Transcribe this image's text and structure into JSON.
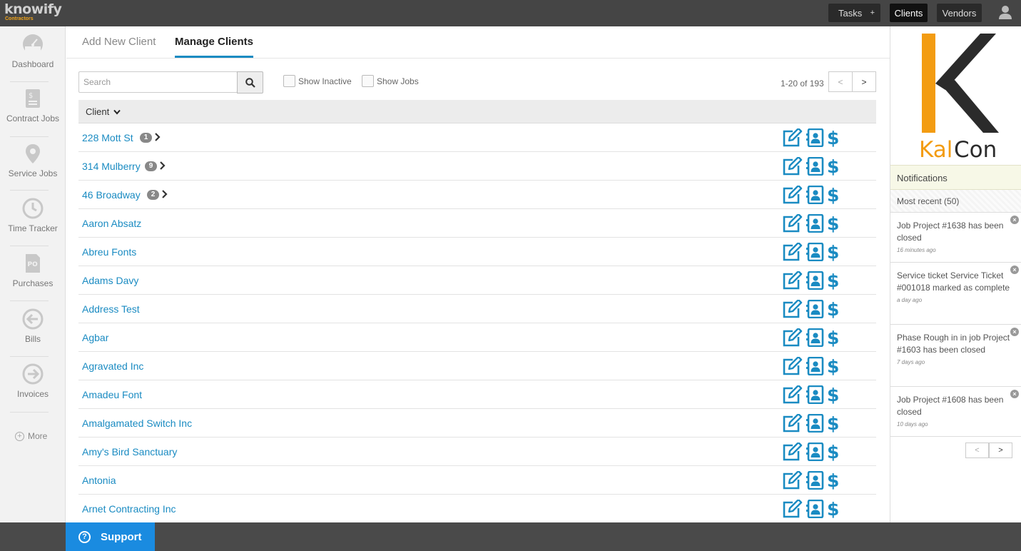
{
  "app": {
    "logo_main": "knowify",
    "logo_sub": "Contractors"
  },
  "topbar": {
    "tasks_label": "Tasks",
    "tasks_plus": "+",
    "clients_label": "Clients",
    "vendors_label": "Vendors"
  },
  "sidebar": {
    "items": [
      {
        "label": "Dashboard",
        "icon": "speedometer-icon"
      },
      {
        "label": "Contract Jobs",
        "icon": "contract-doc-icon"
      },
      {
        "label": "Service Jobs",
        "icon": "map-pin-icon"
      },
      {
        "label": "Time Tracker",
        "icon": "clock-icon"
      },
      {
        "label": "Purchases",
        "icon": "po-doc-icon"
      },
      {
        "label": "Bills",
        "icon": "arrow-left-circle-icon"
      },
      {
        "label": "Invoices",
        "icon": "arrow-right-circle-icon"
      }
    ],
    "more_label": "More"
  },
  "tabs": {
    "add_label": "Add New Client",
    "manage_label": "Manage Clients"
  },
  "toolbar": {
    "search_placeholder": "Search",
    "show_inactive_label": "Show Inactive",
    "show_jobs_label": "Show Jobs",
    "pager_text": "1-20 of 193",
    "prev_label": "<",
    "next_label": ">"
  },
  "table": {
    "header": "Client",
    "rows": [
      {
        "name": "228 Mott St",
        "badge": "1"
      },
      {
        "name": "314 Mulberry",
        "badge": "9"
      },
      {
        "name": "46 Broadway",
        "badge": "2"
      },
      {
        "name": "Aaron Absatz"
      },
      {
        "name": "Abreu Fonts"
      },
      {
        "name": "Adams Davy"
      },
      {
        "name": "Address Test"
      },
      {
        "name": "Agbar"
      },
      {
        "name": "Agravated Inc"
      },
      {
        "name": "Amadeu Font"
      },
      {
        "name": "Amalgamated Switch Inc"
      },
      {
        "name": "Amy's Bird Sanctuary"
      },
      {
        "name": "Antonia"
      },
      {
        "name": "Arnet Contracting Inc"
      }
    ]
  },
  "brand": {
    "name_prefix": "Kal",
    "name_suffix": "Con"
  },
  "notifications": {
    "title": "Notifications",
    "recent_label": "Most recent (50)",
    "items": [
      {
        "message": "Job Project #1638 has been closed",
        "time": "16 minutes ago"
      },
      {
        "message": "Service ticket Service Ticket #001018 marked as complete",
        "time": "a day ago"
      },
      {
        "message": "Phase Rough in in job Project #1603 has been closed",
        "time": "7 days ago"
      },
      {
        "message": "Job Project #1608 has been closed",
        "time": "10 days ago"
      }
    ],
    "prev_label": "<",
    "next_label": ">"
  },
  "footer": {
    "support_label": "Support",
    "support_icon": "?"
  },
  "colors": {
    "accent": "#1a8bc2",
    "brand_orange": "#f39c12",
    "topbar": "#454545"
  }
}
